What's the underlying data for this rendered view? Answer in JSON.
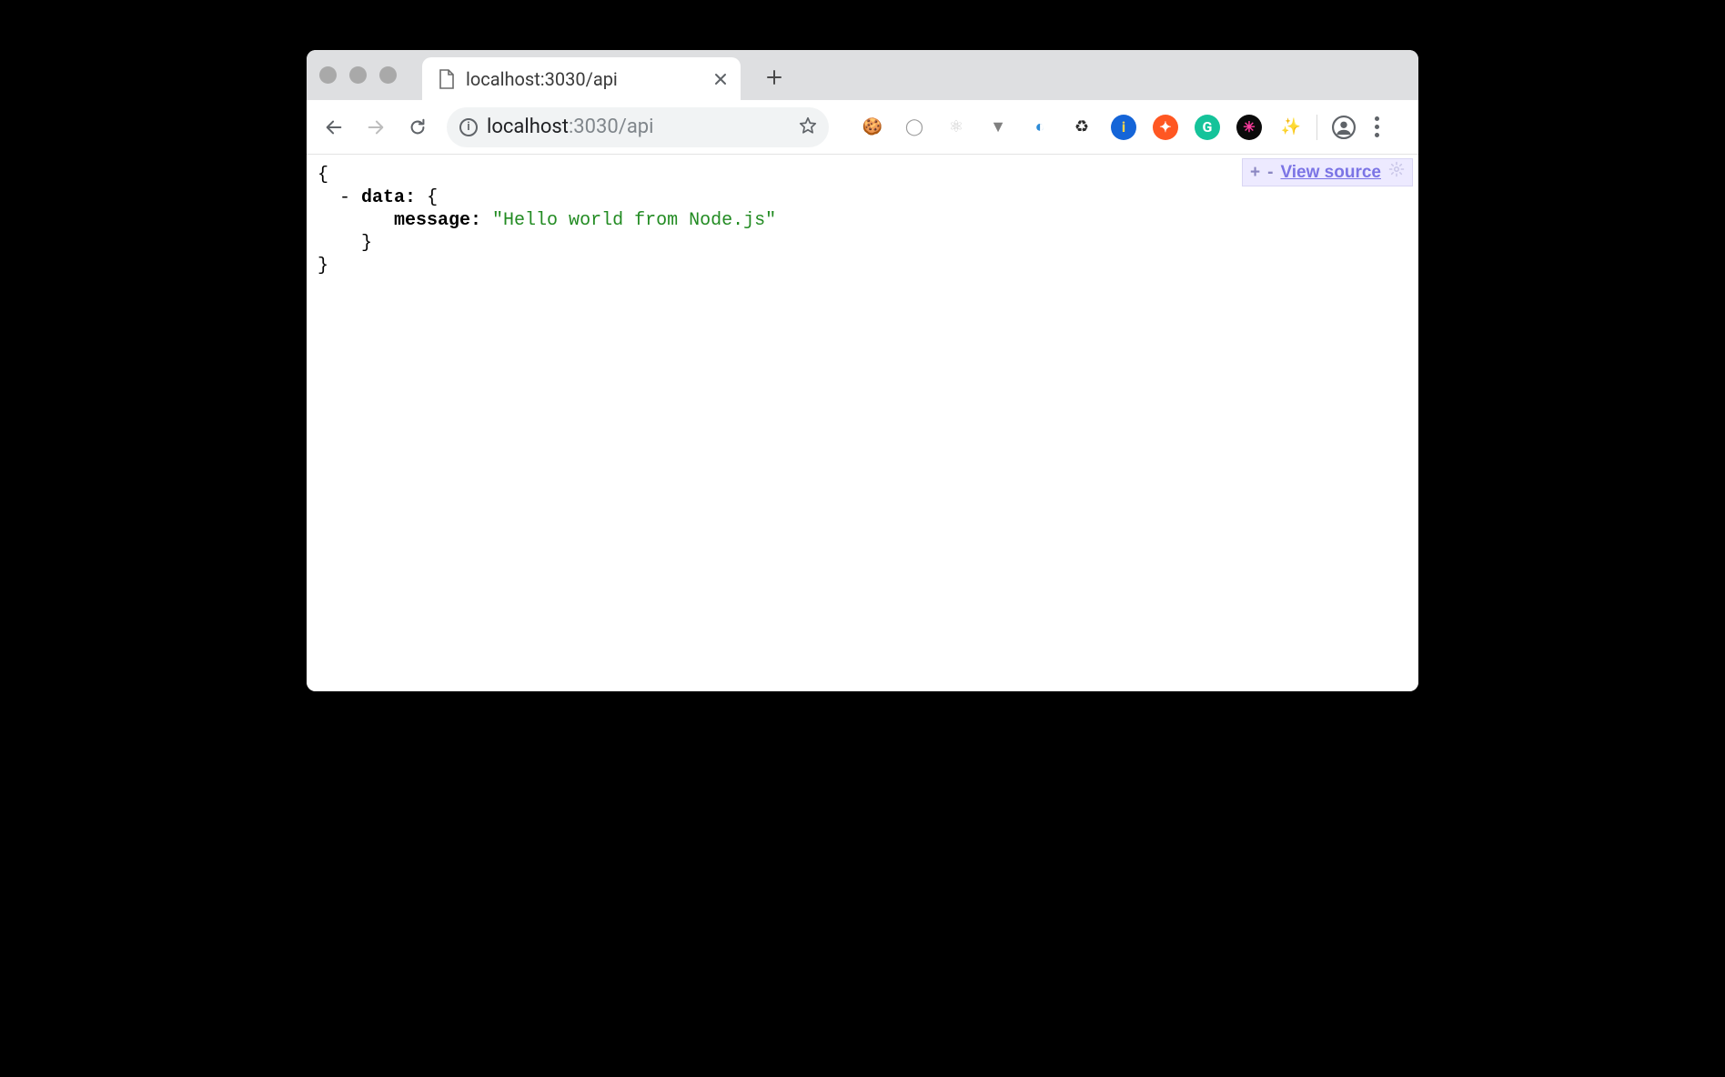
{
  "tab": {
    "title": "localhost:3030/api"
  },
  "omnibox": {
    "host": "localhost",
    "rest": ":3030/api"
  },
  "json": {
    "collapse_marker": "-",
    "key_data": "data:",
    "key_message": "message:",
    "value_message": "\"Hello world from Node.js\""
  },
  "jsonview": {
    "plus": "+",
    "minus": "-",
    "view_source": "View source"
  },
  "extensions": [
    {
      "name": "cookie-icon",
      "bg": "transparent",
      "glyph": "🍪",
      "color": ""
    },
    {
      "name": "recorder-icon",
      "bg": "transparent",
      "glyph": "◯",
      "color": "#9c9c9c"
    },
    {
      "name": "react-icon",
      "bg": "transparent",
      "glyph": "⚛",
      "color": "#cfcfcf"
    },
    {
      "name": "vue-icon",
      "bg": "transparent",
      "glyph": "▼",
      "color": "#808080"
    },
    {
      "name": "opera-icon",
      "bg": "transparent",
      "glyph": "◐",
      "color": "#2d8bd6"
    },
    {
      "name": "recycle-icon",
      "bg": "transparent",
      "glyph": "♻",
      "color": "#2b2b2b"
    },
    {
      "name": "flag-icon",
      "bg": "#1565d8",
      "glyph": "i",
      "color": "#ffd54a"
    },
    {
      "name": "lifebuoy-icon",
      "bg": "#ff5722",
      "glyph": "✦",
      "color": "#fff"
    },
    {
      "name": "grammarly-icon",
      "bg": "#15c39a",
      "glyph": "G",
      "color": "#fff"
    },
    {
      "name": "slack-icon",
      "bg": "#0b0b0b",
      "glyph": "✳",
      "color": "#ff3da1"
    },
    {
      "name": "wand-icon",
      "bg": "transparent",
      "glyph": "✨",
      "color": "#b98ee6"
    }
  ]
}
